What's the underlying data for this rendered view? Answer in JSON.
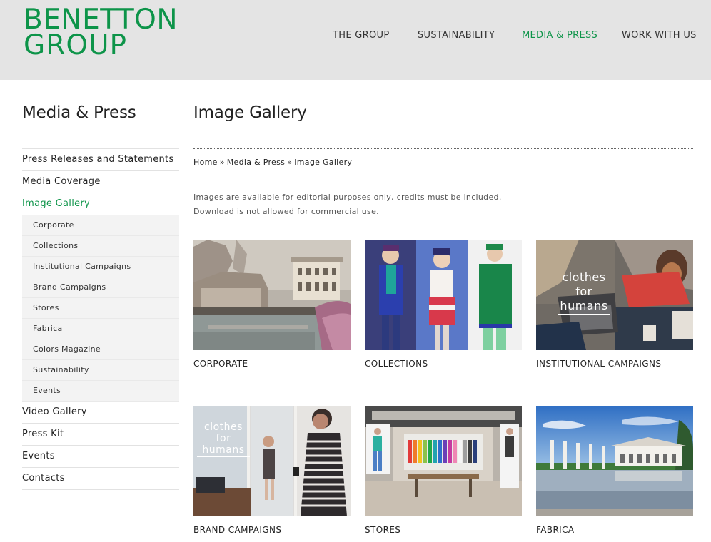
{
  "header": {
    "logo_line1": "BENETTON",
    "logo_line2": "GROUP",
    "nav": [
      {
        "label": "THE GROUP",
        "active": false
      },
      {
        "label": "SUSTAINABILITY",
        "active": false
      },
      {
        "label": "MEDIA & PRESS",
        "active": true
      },
      {
        "label": "WORK WITH US",
        "active": false
      }
    ]
  },
  "sidebar": {
    "title": "Media & Press",
    "items": [
      {
        "label": "Press Releases and Statements"
      },
      {
        "label": "Media Coverage"
      },
      {
        "label": "Image Gallery",
        "active": true
      }
    ],
    "subitems": [
      {
        "label": "Corporate"
      },
      {
        "label": "Collections"
      },
      {
        "label": "Institutional Campaigns"
      },
      {
        "label": "Brand Campaigns"
      },
      {
        "label": "Stores"
      },
      {
        "label": "Fabrica"
      },
      {
        "label": "Colors Magazine"
      },
      {
        "label": "Sustainability"
      },
      {
        "label": "Events"
      }
    ],
    "items_after": [
      {
        "label": "Video Gallery"
      },
      {
        "label": "Press Kit"
      },
      {
        "label": "Events"
      },
      {
        "label": "Contacts"
      }
    ]
  },
  "main": {
    "title": "Image Gallery",
    "breadcrumb": [
      "Home",
      "Media & Press",
      "Image Gallery"
    ],
    "breadcrumb_sep": "»",
    "notice_line1": "Images are available for editorial purposes only, credits must be included.",
    "notice_line2": "Download is not allowed for commercial use.",
    "gallery": [
      {
        "caption": "CORPORATE"
      },
      {
        "caption": "COLLECTIONS"
      },
      {
        "caption": "INSTITUTIONAL CAMPAIGNS",
        "overlay": [
          "clothes",
          "for",
          "humans"
        ]
      },
      {
        "caption": "BRAND CAMPAIGNS",
        "overlay": [
          "clothes",
          "for",
          "humans"
        ]
      },
      {
        "caption": "STORES"
      },
      {
        "caption": "FABRICA"
      }
    ]
  },
  "colors": {
    "brand_green": "#0d9449",
    "header_bg": "#e4e4e4"
  }
}
